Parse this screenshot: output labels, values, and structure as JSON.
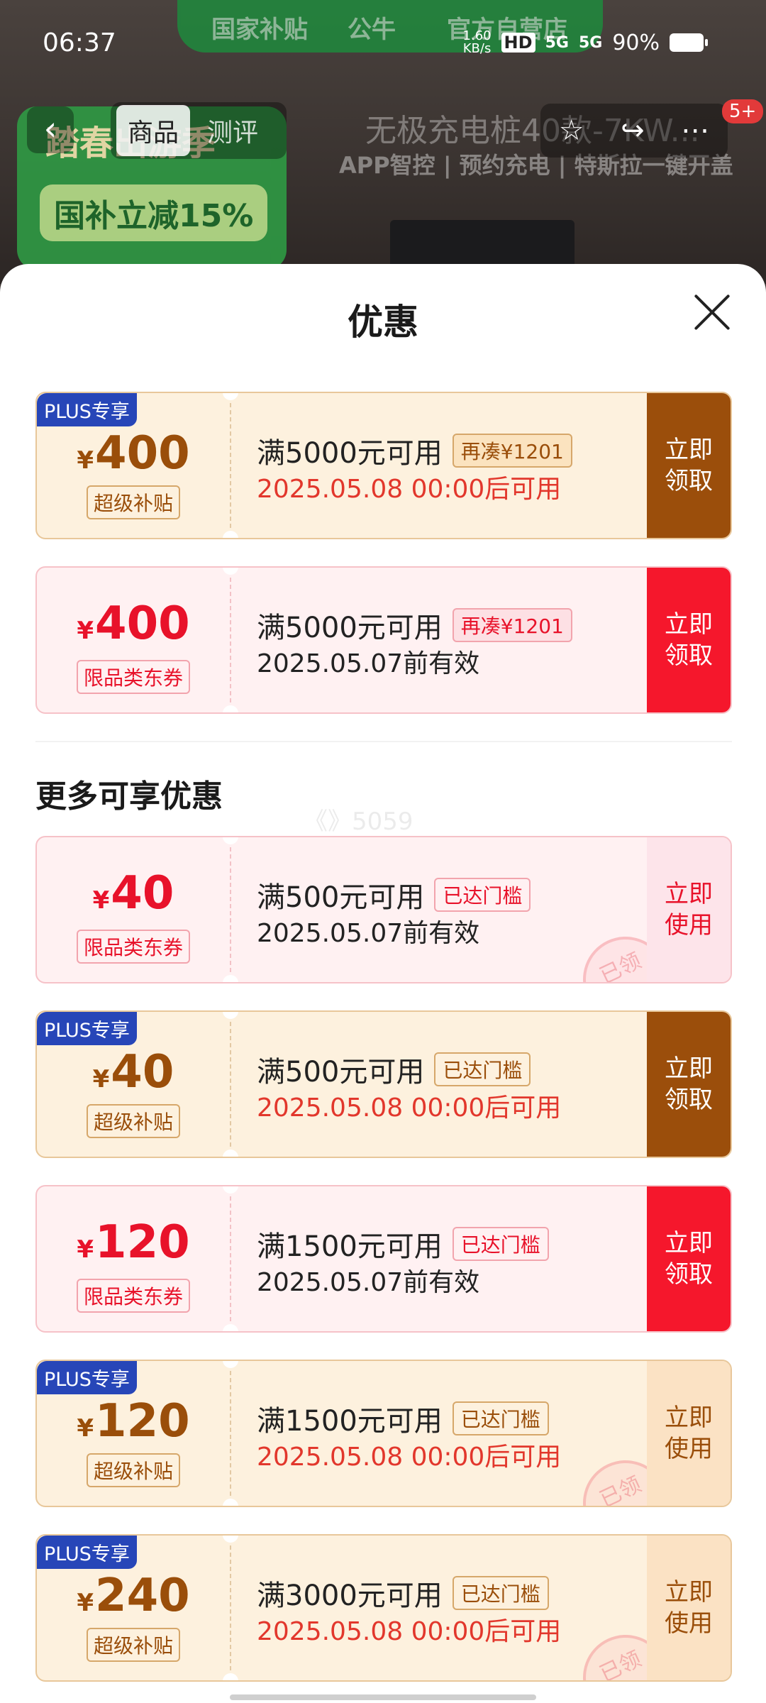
{
  "status_bar": {
    "time": "06:37",
    "speed": "1.60 KB/s",
    "hd": "HD",
    "net1": "5G",
    "net2": "5G",
    "battery": "90%"
  },
  "header": {
    "brand_left": "国家补贴",
    "brand_logo": "公牛",
    "brand_right": "官方自营店",
    "promo_line1": "踏春出游季",
    "promo_line2": "国补立减15%",
    "product_title": "无极充电桩40款-7KW...",
    "product_sub": "APP智控 | 预约充电 | 特斯拉一键开盖",
    "tabs": [
      {
        "label": "商品",
        "active": true
      },
      {
        "label": "测评",
        "active": false
      }
    ],
    "badge": "5+",
    "icons": [
      "back-icon",
      "star-icon",
      "share-icon",
      "more-icon"
    ]
  },
  "sheet": {
    "title": "优惠",
    "more_section_title": "更多可享优惠",
    "watermark": "《》5059"
  },
  "coupons": [
    {
      "style": "gold",
      "plus": "PLUS专享",
      "yen": "¥",
      "amount": "400",
      "kind": "超级补贴",
      "condition": "满5000元可用",
      "tag": "再凑¥1201",
      "validity": "2025.05.08 00:00后可用",
      "validity_color": "red",
      "action": "立即领取",
      "action_style": "brown",
      "claimed": ""
    },
    {
      "style": "pink",
      "plus": "",
      "yen": "¥",
      "amount": "400",
      "kind": "限品类东券",
      "condition": "满5000元可用",
      "tag": "再凑¥1201",
      "validity": "2025.05.07前有效",
      "validity_color": "dark",
      "action": "立即领取",
      "action_style": "red",
      "claimed": ""
    },
    {
      "style": "pink",
      "plus": "",
      "yen": "¥",
      "amount": "40",
      "kind": "限品类东券",
      "condition": "满500元可用",
      "tag": "已达门槛",
      "validity": "2025.05.07前有效",
      "validity_color": "dark",
      "action": "立即使用",
      "action_style": "light-pink",
      "claimed": "已领"
    },
    {
      "style": "gold",
      "plus": "PLUS专享",
      "yen": "¥",
      "amount": "40",
      "kind": "超级补贴",
      "condition": "满500元可用",
      "tag": "已达门槛",
      "validity": "2025.05.08 00:00后可用",
      "validity_color": "red",
      "action": "立即领取",
      "action_style": "brown",
      "claimed": ""
    },
    {
      "style": "pink",
      "plus": "",
      "yen": "¥",
      "amount": "120",
      "kind": "限品类东券",
      "condition": "满1500元可用",
      "tag": "已达门槛",
      "validity": "2025.05.07前有效",
      "validity_color": "dark",
      "action": "立即领取",
      "action_style": "red",
      "claimed": ""
    },
    {
      "style": "gold",
      "plus": "PLUS专享",
      "yen": "¥",
      "amount": "120",
      "kind": "超级补贴",
      "condition": "满1500元可用",
      "tag": "已达门槛",
      "validity": "2025.05.08 00:00后可用",
      "validity_color": "red",
      "action": "立即使用",
      "action_style": "light-gold",
      "claimed": "已领"
    },
    {
      "style": "gold",
      "plus": "PLUS专享",
      "yen": "¥",
      "amount": "240",
      "kind": "超级补贴",
      "condition": "满3000元可用",
      "tag": "已达门槛",
      "validity": "2025.05.08 00:00后可用",
      "validity_color": "red",
      "action": "立即使用",
      "action_style": "light-gold",
      "claimed": "已领"
    }
  ],
  "colors": {
    "plus_blue": "#2746b8",
    "gold_text": "#9a4e0a",
    "red_text": "#e8122a",
    "brown_button": "#9b4e0b",
    "red_button": "#f5172c"
  }
}
